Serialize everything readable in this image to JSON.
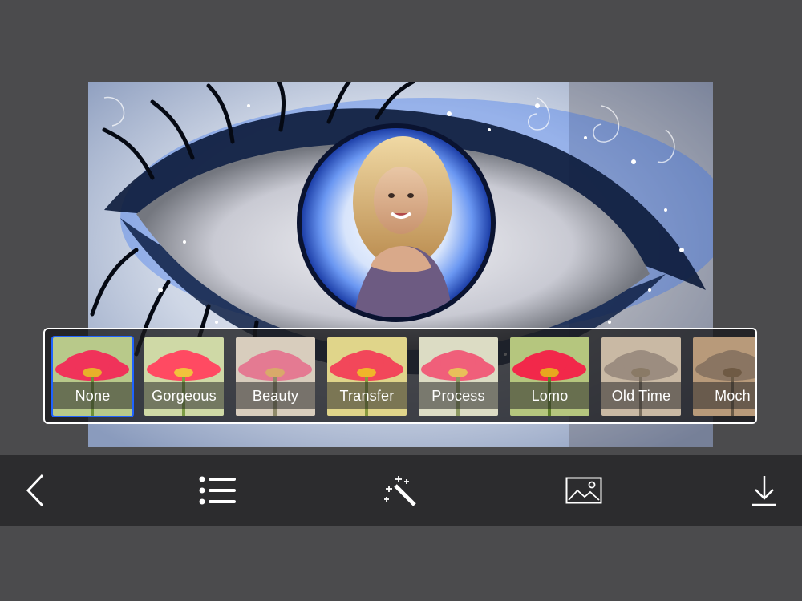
{
  "filters": [
    {
      "label": "None",
      "selected": true
    },
    {
      "label": "Gorgeous",
      "selected": false
    },
    {
      "label": "Beauty",
      "selected": false
    },
    {
      "label": "Transfer",
      "selected": false
    },
    {
      "label": "Process",
      "selected": false
    },
    {
      "label": "Lomo",
      "selected": false
    },
    {
      "label": "Old Time",
      "selected": false
    },
    {
      "label": "Moch",
      "selected": false
    }
  ],
  "toolbar": {
    "items": [
      {
        "icon": "back-chevron-icon"
      },
      {
        "icon": "list-icon"
      },
      {
        "icon": "magic-wand-icon"
      },
      {
        "icon": "image-icon"
      },
      {
        "icon": "download-icon"
      }
    ]
  },
  "colors": {
    "background": "#4b4b4d",
    "toolbar": "#2c2c2e",
    "selection": "#1f63ff",
    "strip_border": "#ffffff"
  }
}
